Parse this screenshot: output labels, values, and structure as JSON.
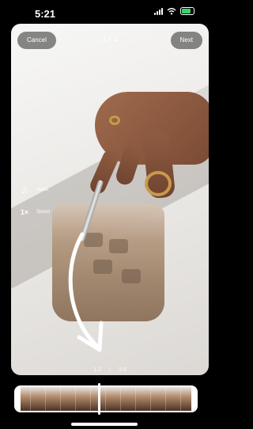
{
  "status": {
    "time": "5:21"
  },
  "header": {
    "cancel_label": "Cancel",
    "next_label": "Next",
    "counter_text": "1 / 1"
  },
  "tools": [
    {
      "icon": "music-note-icon",
      "glyph": "♫",
      "label": "Audio"
    },
    {
      "icon": "speed-icon",
      "glyph": "1×",
      "label": "Speed"
    }
  ],
  "playback": {
    "position": "1.2",
    "separator": "/",
    "duration": "3.9"
  },
  "colors": {
    "accent": "#ffffff",
    "battery": "#3ad36b",
    "background": "#000000"
  }
}
